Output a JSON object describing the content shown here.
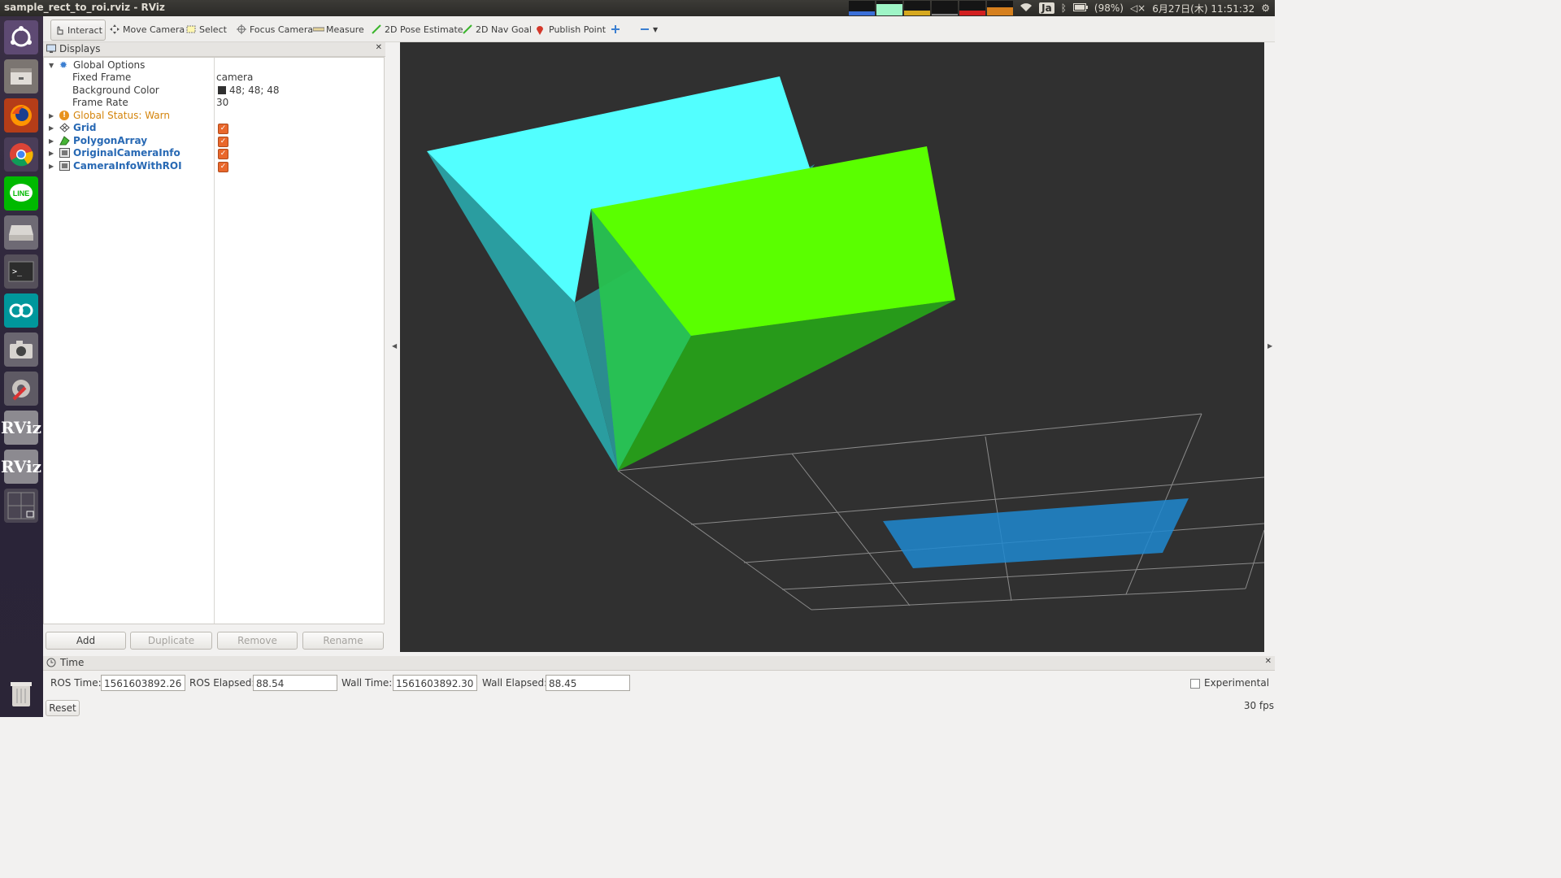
{
  "window": {
    "title": "sample_rect_to_roi.rviz - RViz"
  },
  "tray": {
    "battery": "(98%)",
    "keyboard": "Ja",
    "datetime": "6月27日(木) 11:51:32"
  },
  "launcher": {
    "items": [
      "ubuntu-dash",
      "files",
      "firefox",
      "chrome",
      "line",
      "drive",
      "terminal",
      "arduino",
      "camera",
      "settings",
      "rviz",
      "rviz",
      "workspace-switcher",
      "trash"
    ]
  },
  "toolbar": {
    "interact": "Interact",
    "move_camera": "Move Camera",
    "select": "Select",
    "focus_camera": "Focus Camera",
    "measure": "Measure",
    "pose_estimate": "2D Pose Estimate",
    "nav_goal": "2D Nav Goal",
    "publish_point": "Publish Point"
  },
  "displays": {
    "title": "Displays",
    "global_options": "Global Options",
    "fixed_frame_label": "Fixed Frame",
    "fixed_frame_value": "camera",
    "bg_color_label": "Background Color",
    "bg_color_value": "48; 48; 48",
    "frame_rate_label": "Frame Rate",
    "frame_rate_value": "30",
    "global_status": "Global Status: Warn",
    "items": [
      "Grid",
      "PolygonArray",
      "OriginalCameraInfo",
      "CameraInfoWithROI"
    ],
    "buttons": {
      "add": "Add",
      "duplicate": "Duplicate",
      "remove": "Remove",
      "rename": "Rename"
    }
  },
  "time": {
    "title": "Time",
    "ros_time_label": "ROS Time:",
    "ros_time": "1561603892.26",
    "ros_elapsed_label": "ROS Elapsed:",
    "ros_elapsed": "88.54",
    "wall_time_label": "Wall Time:",
    "wall_time": "1561603892.30",
    "wall_elapsed_label": "Wall Elapsed:",
    "wall_elapsed": "88.45",
    "experimental": "Experimental",
    "reset": "Reset",
    "fps": "30 fps"
  },
  "colors": {
    "viewport_bg": "#303030",
    "cyan": "#52ffff",
    "green": "#5aff00",
    "blue_roi": "#1e88d0"
  }
}
